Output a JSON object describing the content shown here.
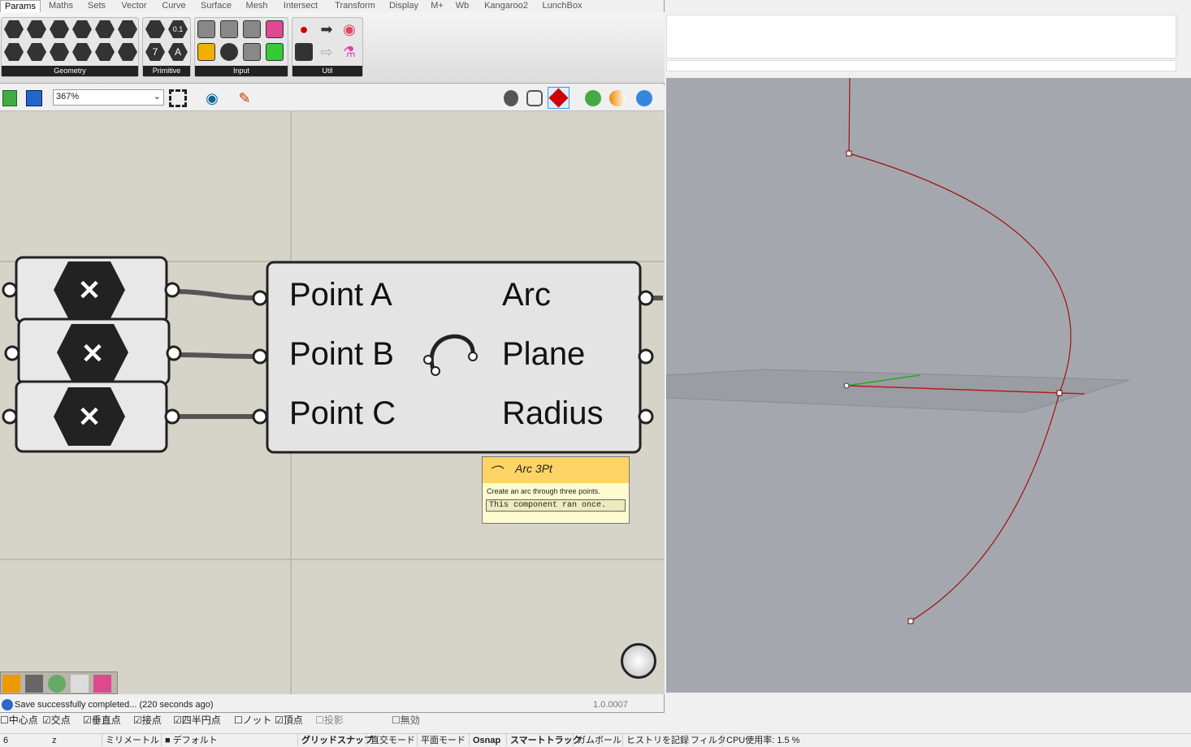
{
  "gh": {
    "tabs": [
      "Params",
      "Maths",
      "Sets",
      "Vector",
      "Curve",
      "Surface",
      "Mesh",
      "Intersect",
      "Transform",
      "Display",
      "M+",
      "Wb",
      "Kangaroo2",
      "LunchBox"
    ],
    "groups": [
      "Geometry",
      "Primitive",
      "Input",
      "Util"
    ],
    "primitive_icons": [
      "0.1",
      "7",
      "A"
    ],
    "zoom": "367%",
    "component": {
      "inputs": [
        "Point A",
        "Point B",
        "Point C"
      ],
      "outputs": [
        "Arc",
        "Plane",
        "Radius"
      ],
      "icon": "arc-3pt-icon"
    },
    "tooltip": {
      "title": "Arc 3Pt",
      "description": "Create an arc through three points.",
      "status": "This component ran once."
    },
    "status": "Save successfully completed... (220 seconds ago)",
    "version": "1.0.0007"
  },
  "osnap": [
    {
      "label": "中心点",
      "checked": false
    },
    {
      "label": "交点",
      "checked": true
    },
    {
      "label": "垂直点",
      "checked": true
    },
    {
      "label": "接点",
      "checked": true
    },
    {
      "label": "四半円点",
      "checked": true
    },
    {
      "label": "ノット",
      "checked": false
    },
    {
      "label": "頂点",
      "checked": true
    },
    {
      "label": "投影",
      "checked": false
    },
    {
      "label": "無効",
      "checked": false
    }
  ],
  "status_bar": {
    "coord": "6",
    "z": "z",
    "units": "ミリメートル",
    "layer": "デフォルト",
    "grid_snap": "グリッドスナップ",
    "ortho": "直交モード",
    "planar": "平面モード",
    "osnap": "Osnap",
    "smarttrack": "スマートトラック",
    "gumball": "ガムボール",
    "history": "ヒストリを記録",
    "filter": "フィルタ",
    "cpu": "CPU使用率: 1.5 %"
  },
  "colors": {
    "canvas": "#d6d3c8",
    "viewport": "#a4a8ae",
    "curve": "#a01010",
    "tooltip_header": "#ffd466"
  }
}
